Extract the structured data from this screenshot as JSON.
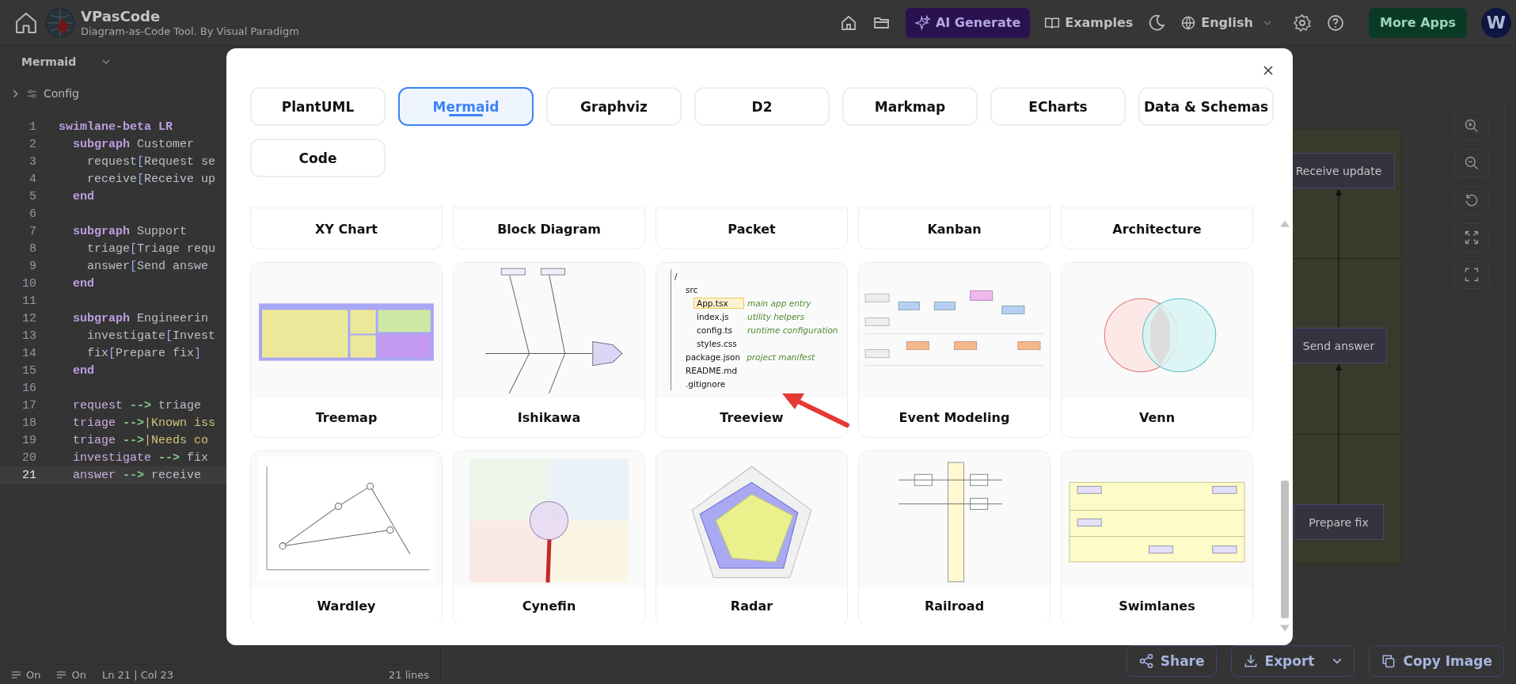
{
  "header": {
    "title": "VPasCode",
    "subtitle": "Diagram-as-Code Tool. By Visual Paradigm",
    "ai_button": "AI Generate",
    "examples_button": "Examples",
    "language": "English",
    "more_apps_button": "More Apps",
    "avatar": "W"
  },
  "editor": {
    "language": "Mermaid",
    "config_label": "Config",
    "lines": [
      {
        "number": "1",
        "current": false,
        "tokens": [
          {
            "text": "swimlane-beta LR",
            "kind": "keyword"
          }
        ]
      },
      {
        "number": "2",
        "current": false,
        "tokens": [
          {
            "text": "  subgraph",
            "kind": "keyword"
          },
          {
            "text": " Customer",
            "kind": "plain"
          }
        ]
      },
      {
        "number": "3",
        "current": false,
        "tokens": [
          {
            "text": "    request",
            "kind": "plain"
          },
          {
            "text": "[",
            "kind": "bracket"
          },
          {
            "text": "Request se",
            "kind": "plain"
          }
        ]
      },
      {
        "number": "4",
        "current": false,
        "tokens": [
          {
            "text": "    receive",
            "kind": "plain"
          },
          {
            "text": "[",
            "kind": "bracket"
          },
          {
            "text": "Receive up",
            "kind": "plain"
          }
        ]
      },
      {
        "number": "5",
        "current": false,
        "tokens": [
          {
            "text": "  end",
            "kind": "keyword"
          }
        ]
      },
      {
        "number": "6",
        "current": false
      },
      {
        "number": "7",
        "current": false,
        "tokens": [
          {
            "text": "  subgraph",
            "kind": "keyword"
          },
          {
            "text": " Support",
            "kind": "plain"
          }
        ]
      },
      {
        "number": "8",
        "current": false,
        "tokens": [
          {
            "text": "    triage",
            "kind": "plain"
          },
          {
            "text": "[",
            "kind": "bracket"
          },
          {
            "text": "Triage requ",
            "kind": "plain"
          }
        ]
      },
      {
        "number": "9",
        "current": false,
        "tokens": [
          {
            "text": "    answer",
            "kind": "plain"
          },
          {
            "text": "[",
            "kind": "bracket"
          },
          {
            "text": "Send answe",
            "kind": "plain"
          }
        ]
      },
      {
        "number": "10",
        "current": false,
        "tokens": [
          {
            "text": "  end",
            "kind": "keyword"
          }
        ]
      },
      {
        "number": "11",
        "current": false
      },
      {
        "number": "12",
        "current": false,
        "tokens": [
          {
            "text": "  subgraph",
            "kind": "keyword"
          },
          {
            "text": " Engineerin",
            "kind": "plain"
          }
        ]
      },
      {
        "number": "13",
        "current": false,
        "tokens": [
          {
            "text": "    investigate",
            "kind": "plain"
          },
          {
            "text": "[",
            "kind": "bracket"
          },
          {
            "text": "Invest",
            "kind": "plain"
          }
        ]
      },
      {
        "number": "14",
        "current": false,
        "tokens": [
          {
            "text": "    fix",
            "kind": "plain"
          },
          {
            "text": "[",
            "kind": "bracket"
          },
          {
            "text": "Prepare fix",
            "kind": "plain"
          },
          {
            "text": "]",
            "kind": "bracket"
          }
        ]
      },
      {
        "number": "15",
        "current": false,
        "tokens": [
          {
            "text": "  end",
            "kind": "keyword"
          }
        ]
      },
      {
        "number": "16",
        "current": false
      },
      {
        "number": "17",
        "current": false,
        "tokens": [
          {
            "text": "  request",
            "kind": "ident"
          },
          {
            "text": " -->",
            "kind": "arrow"
          },
          {
            "text": " triage",
            "kind": "plain"
          }
        ]
      },
      {
        "number": "18",
        "current": false,
        "tokens": [
          {
            "text": "  triage",
            "kind": "ident"
          },
          {
            "text": " -->",
            "kind": "arrow"
          },
          {
            "text": "|Known iss",
            "kind": "label"
          }
        ]
      },
      {
        "number": "19",
        "current": false,
        "tokens": [
          {
            "text": "  triage",
            "kind": "ident"
          },
          {
            "text": " -->",
            "kind": "arrow"
          },
          {
            "text": "|Needs co",
            "kind": "label"
          }
        ]
      },
      {
        "number": "20",
        "current": false,
        "tokens": [
          {
            "text": "  investigate",
            "kind": "ident"
          },
          {
            "text": " -->",
            "kind": "arrow"
          },
          {
            "text": " fix",
            "kind": "plain"
          }
        ]
      },
      {
        "number": "21",
        "current": true,
        "tokens": [
          {
            "text": "  answer",
            "kind": "ident"
          },
          {
            "text": " -->",
            "kind": "arrow"
          },
          {
            "text": " receive",
            "kind": "plain"
          }
        ]
      }
    ]
  },
  "status_bar": {
    "toggles": [
      "On",
      "On"
    ],
    "position": "Ln 21 | Col 23",
    "line_count": "21 lines"
  },
  "canvas": {
    "nodes": [
      "Receive update",
      "Send answer",
      "Prepare fix"
    ]
  },
  "actions": [
    "Share",
    "Export",
    "Copy Image"
  ],
  "modal": {
    "tabs": [
      {
        "label": "PlantUML",
        "selected": false
      },
      {
        "label": "Mermaid",
        "selected": true
      },
      {
        "label": "Graphviz",
        "selected": false
      },
      {
        "label": "D2",
        "selected": false
      },
      {
        "label": "Markmap",
        "selected": false
      },
      {
        "label": "ECharts",
        "selected": false
      },
      {
        "label": "Data & Schemas",
        "selected": false
      },
      {
        "label": "Code",
        "selected": false
      }
    ],
    "cards": [
      {
        "label": "XY Chart"
      },
      {
        "label": "Block Diagram"
      },
      {
        "label": "Packet"
      },
      {
        "label": "Kanban"
      },
      {
        "label": "Architecture"
      },
      {
        "label": "Treemap",
        "kind": "picture"
      },
      {
        "label": "Ishikawa",
        "kind": "picture"
      },
      {
        "label": "Treeview",
        "kind": "tree",
        "tree": [
          {
            "label": "/",
            "selected": false,
            "children": [
              {
                "label": "src",
                "selected": false,
                "children": [
                  {
                    "label": "App.tsx",
                    "note": "main app entry",
                    "selected": true
                  },
                  {
                    "label": "index.js",
                    "note": "utility helpers",
                    "selected": false
                  },
                  {
                    "label": "config.ts",
                    "note": "runtime configuration",
                    "selected": false
                  },
                  {
                    "label": "styles.css",
                    "selected": false
                  }
                ]
              },
              {
                "label": "package.json",
                "note": "project manifest",
                "selected": false
              },
              {
                "label": "README.md",
                "selected": false
              },
              {
                "label": ".gitignore",
                "selected": false
              }
            ]
          }
        ]
      },
      {
        "label": "Event Modeling",
        "kind": "picture"
      },
      {
        "label": "Venn",
        "kind": "picture"
      },
      {
        "label": "Wardley",
        "kind": "picture"
      },
      {
        "label": "Cynefin",
        "kind": "picture"
      },
      {
        "label": "Radar",
        "kind": "picture"
      },
      {
        "label": "Railroad",
        "kind": "picture"
      },
      {
        "label": "Swimlanes",
        "kind": "picture"
      }
    ]
  }
}
